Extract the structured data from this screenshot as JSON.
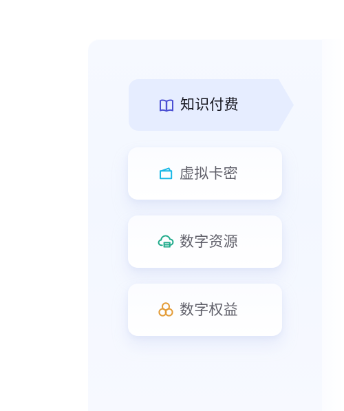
{
  "menu": {
    "items": [
      {
        "label": "知识付费",
        "icon": "book-icon",
        "accent": "#4b4fd3",
        "state": "active"
      },
      {
        "label": "虚拟卡密",
        "icon": "virtual-card-icon",
        "accent": "#19b8e6",
        "state": "inactive"
      },
      {
        "label": "数字资源",
        "icon": "cloud-archive-icon",
        "accent": "#1faa8a",
        "state": "inactive"
      },
      {
        "label": "数字权益",
        "icon": "linked-circles-icon",
        "accent": "#e39b36",
        "state": "inactive"
      }
    ]
  },
  "colors": {
    "active_background": "#e6edff",
    "panel_background": "#f5f8ff",
    "text_active": "#16161f",
    "text_inactive": "#5e5e68"
  }
}
